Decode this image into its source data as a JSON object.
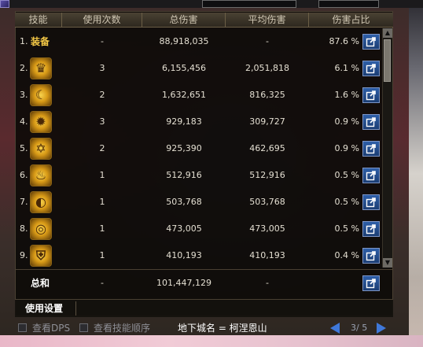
{
  "header": {
    "columns": [
      "技能",
      "使用次数",
      "总伤害",
      "平均伤害",
      "伤害占比"
    ]
  },
  "rows": [
    {
      "rank": "1.",
      "skill_name": "装备",
      "icon": "equipment",
      "uses": "-",
      "total": "88,918,035",
      "average": "-",
      "share": "87.6 %"
    },
    {
      "rank": "2.",
      "icon": "crown-skill-icon",
      "uses": "3",
      "total": "6,155,456",
      "average": "2,051,818",
      "share": "6.1 %"
    },
    {
      "rank": "3.",
      "icon": "crescent-slash-skill-icon",
      "uses": "2",
      "total": "1,632,651",
      "average": "816,325",
      "share": "1.6 %"
    },
    {
      "rank": "4.",
      "icon": "flame-burst-skill-icon",
      "uses": "3",
      "total": "929,183",
      "average": "309,727",
      "share": "0.9 %"
    },
    {
      "rank": "5.",
      "icon": "star-sigil-skill-icon",
      "uses": "2",
      "total": "925,390",
      "average": "462,695",
      "share": "0.9 %"
    },
    {
      "rank": "6.",
      "icon": "fire-aura-skill-icon",
      "uses": "1",
      "total": "512,916",
      "average": "512,916",
      "share": "0.5 %"
    },
    {
      "rank": "7.",
      "icon": "moon-wave-skill-icon",
      "uses": "1",
      "total": "503,768",
      "average": "503,768",
      "share": "0.5 %"
    },
    {
      "rank": "8.",
      "icon": "spiral-skill-icon",
      "uses": "1",
      "total": "473,005",
      "average": "473,005",
      "share": "0.5 %"
    },
    {
      "rank": "9.",
      "icon": "shield-skill-icon",
      "uses": "1",
      "total": "410,193",
      "average": "410,193",
      "share": "0.4 %"
    }
  ],
  "total": {
    "label": "总和",
    "uses": "-",
    "total": "101,447,129",
    "average": "-"
  },
  "settings": {
    "title": "使用设置"
  },
  "footer": {
    "checkbox_dps": "查看DPS",
    "checkbox_order": "查看技能顺序",
    "dungeon": "地下城名 = 柯涅恩山",
    "page": "3/ 5"
  },
  "colors": {
    "accent_gold": "#f4c846",
    "button_blue": "#2e5fa8"
  }
}
